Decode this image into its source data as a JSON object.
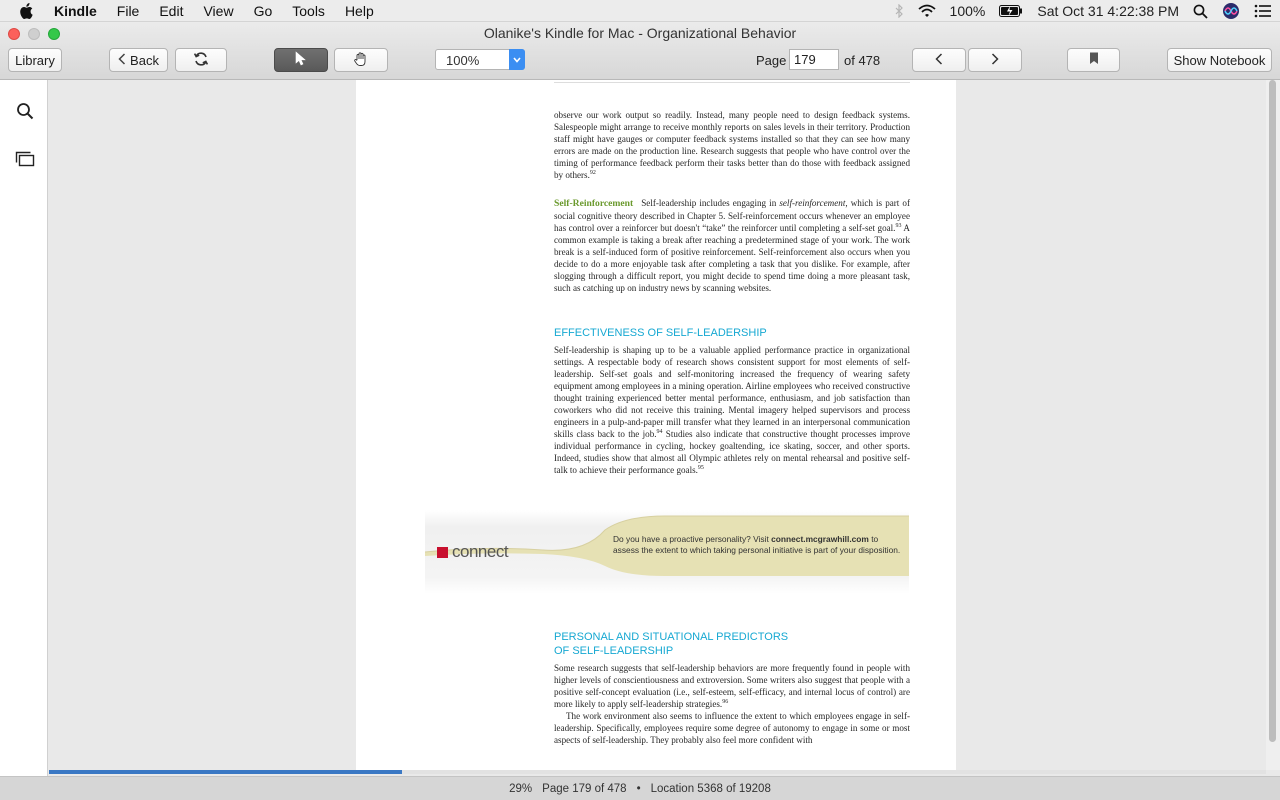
{
  "menubar": {
    "app_name": "Kindle",
    "items": [
      "File",
      "Edit",
      "View",
      "Go",
      "Tools",
      "Help"
    ],
    "battery": "100%",
    "clock": "Sat Oct 31  4:22:38 PM"
  },
  "window": {
    "title": "Olanike's Kindle for Mac - Organizational Behavior"
  },
  "toolbar": {
    "library_label": "Library",
    "back_label": "Back",
    "zoom_value": "100%",
    "page_label": "Page",
    "page_value": "179",
    "page_total": "of 478",
    "notebook_label": "Show Notebook"
  },
  "book": {
    "para_feedback": "observe our work output so readily. Instead, many people need to design feedback systems. Salespeople might arrange to receive monthly reports on sales levels in their territory. Production staff might have gauges or computer feedback systems installed so that they can see how many errors are made on the production line. Research suggests that people who have control over the timing of performance feedback perform their tasks better than do those with feedback assigned by others.",
    "fn92": "92",
    "self_reinforcement_head": "Self-Reinforcement",
    "sr_part1": "Self-leadership includes engaging in ",
    "sr_italic": "self-reinforcement,",
    "sr_part2": " which is part of social cognitive theory described in Chapter 5. Self-reinforcement occurs whenever an employee has control over a reinforcer but doesn't “take” the reinforcer until completing a self-set goal.",
    "fn93": "93",
    "sr_part3": " A common example is taking a break after reaching a predetermined stage of your work. The work break is a self-induced form of positive reinforcement. Self-reinforcement also occurs when you decide to do a more enjoyable task after completing a task that you dislike. For example, after slogging through a difficult report, you might decide to spend time doing a more pleasant task, such as catching up on industry news by scanning websites.",
    "effectiveness_head": "EFFECTIVENESS OF SELF-LEADERSHIP",
    "eff_part1": "Self-leadership is shaping up to be a valuable applied performance practice in organizational settings. A respectable body of research shows consistent support for most elements of self-leadership. Self-set goals and self-monitoring increased the frequency of wearing safety equipment among employees in a mining operation. Airline employees who received constructive thought training experienced better mental performance, enthusiasm, and job satisfaction than coworkers who did not receive this training. Mental imagery helped supervisors and process engineers in a pulp-and-paper mill transfer what they learned in an interpersonal communication skills class back to the job.",
    "fn94": "94",
    "eff_part2": " Studies also indicate that constructive thought processes improve individual performance in cycling, hockey goaltending, ice skating, soccer, and other sports. Indeed, studies show that almost all Olympic athletes rely on mental rehearsal and positive self-talk to achieve their performance goals.",
    "fn95": "95",
    "connect_brand": "connect",
    "connect_text1": "Do you have a proactive personality? Visit ",
    "connect_url": "connect.mcgrawhill.com",
    "connect_text2": " to assess the extent to which taking personal initiative is part of your disposition.",
    "predictors_head_line1": "PERSONAL AND SITUATIONAL PREDICTORS",
    "predictors_head_line2": "OF SELF-LEADERSHIP",
    "pred_para1": "Some research suggests that self-leadership behaviors are more frequently found in people with higher levels of conscientiousness and extroversion. Some writers also suggest that people with a positive self-concept evaluation (i.e., self-esteem, self-efficacy, and internal locus of control) are more likely to apply self-leadership strategies.",
    "fn96": "96",
    "pred_para2": "The work environment also seems to influence the extent to which employees engage in self-leadership. Specifically, employees require some degree of autonomy to engage in some or most aspects of self-leadership. They probably also feel more confident with"
  },
  "status": {
    "percent": "29%",
    "page_text": "Page 179 of 478",
    "location_text": "Location 5368 of 19208",
    "progress_fraction": 0.29
  }
}
